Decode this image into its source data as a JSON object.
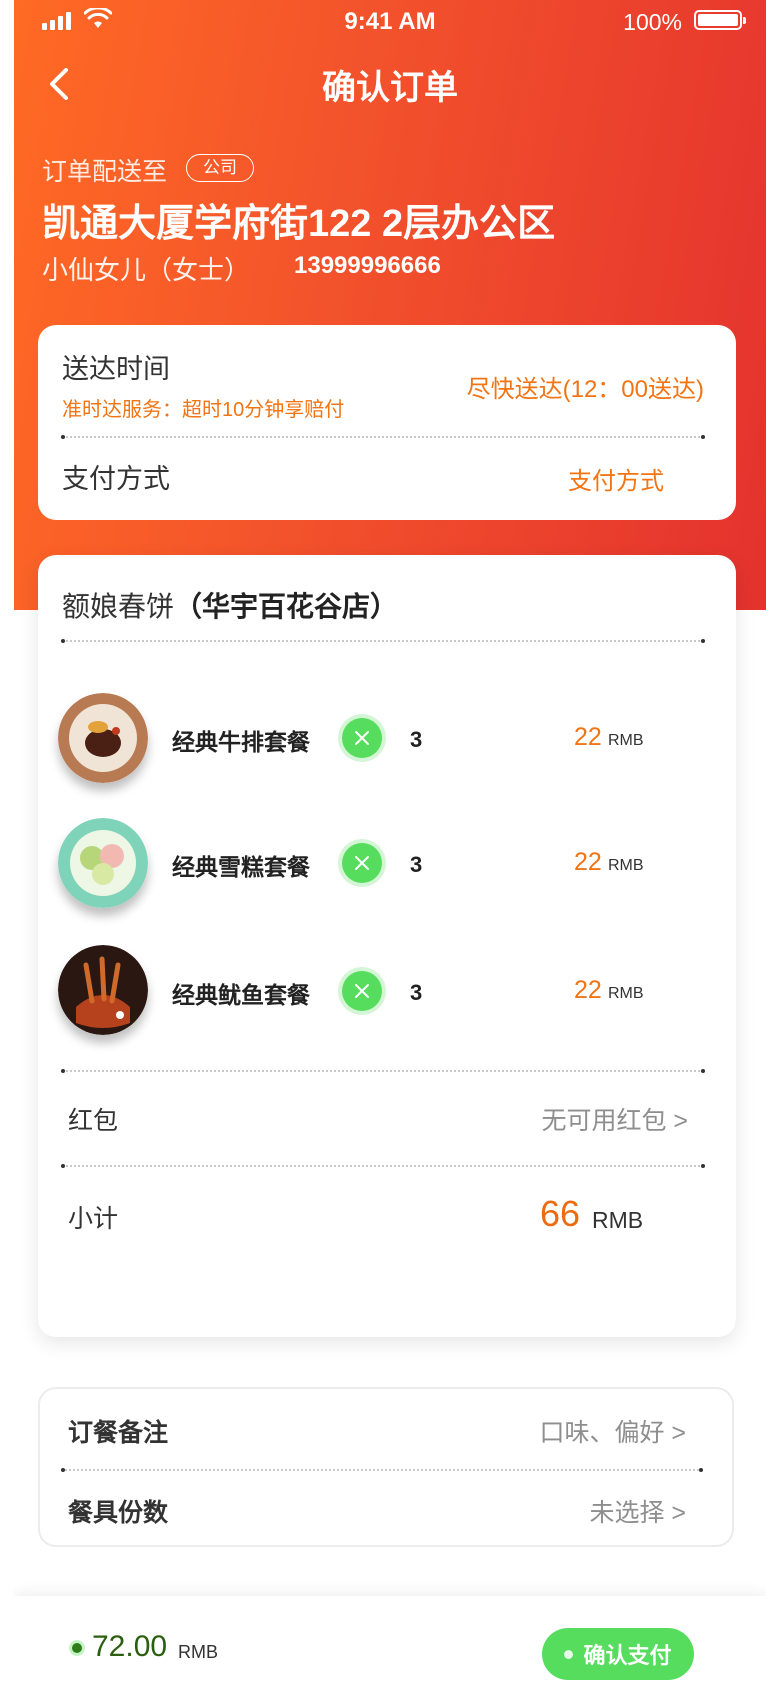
{
  "status": {
    "time": "9:41 AM",
    "battery": "100%"
  },
  "nav": {
    "title": "确认订单"
  },
  "address": {
    "label": "订单配送至",
    "tag": "公司",
    "line": "凯通大厦学府街122  2层办公区",
    "receiver": "小仙女儿（女士）",
    "phone": "13999996666"
  },
  "delivery": {
    "label": "送达时间",
    "guarantee": "准时达服务：超时10分钟享赔付",
    "value": "尽快送达(12：00送达)",
    "payment_label": "支付方式",
    "payment_value": "支付方式"
  },
  "store": {
    "name": "额娘春饼",
    "branch": "（华宇百花谷店）"
  },
  "items": [
    {
      "name": "经典牛排套餐",
      "qty": "3",
      "price": "22",
      "unit": "RMB",
      "image": "steak-dish"
    },
    {
      "name": "经典雪糕套餐",
      "qty": "3",
      "price": "22",
      "unit": "RMB",
      "image": "ice-cream-dish"
    },
    {
      "name": "经典鱿鱼套餐",
      "qty": "3",
      "price": "22",
      "unit": "RMB",
      "image": "squid-dish"
    }
  ],
  "redpacket": {
    "label": "红包",
    "value": "无可用红包 >"
  },
  "subtotal": {
    "label": "小计",
    "amount": "66",
    "unit": "RMB"
  },
  "extras": {
    "note_label": "订餐备注",
    "note_value": "口味、偏好 >",
    "tableware_label": "餐具份数",
    "tableware_value": "未选择 >"
  },
  "footer": {
    "total": "72.00",
    "unit": "RMB",
    "pay_label": "确认支付"
  },
  "colors": {
    "accent": "#f27413",
    "gradient_start": "#ff6a24",
    "gradient_end": "#e4322e",
    "green": "#56dd5d"
  }
}
